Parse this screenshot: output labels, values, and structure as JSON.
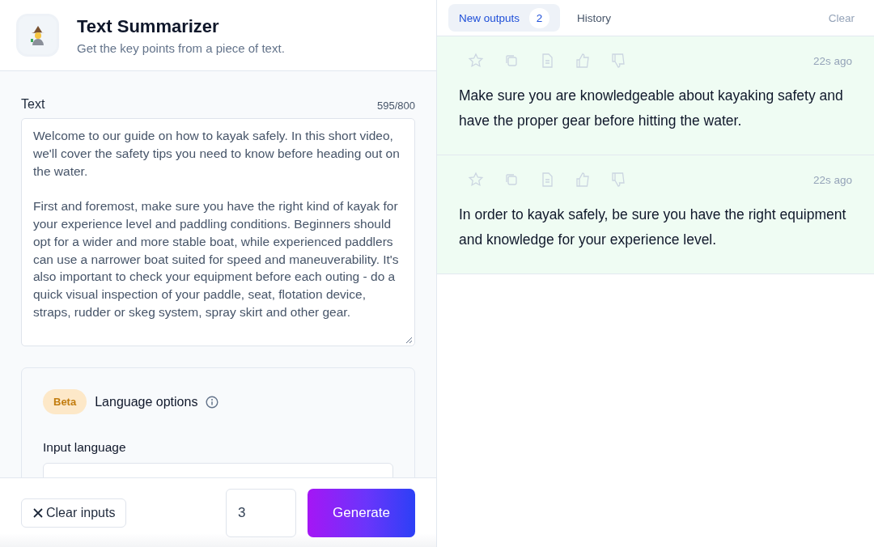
{
  "app": {
    "title": "Text Summarizer",
    "subtitle": "Get the key points from a piece of text."
  },
  "form": {
    "text_label": "Text",
    "counter": "595/800",
    "text_value": "Welcome to our guide on how to kayak safely. In this short video, we'll cover the safety tips you need to know before heading out on the water.\n\nFirst and foremost, make sure you have the right kind of kayak for your experience level and paddling conditions. Beginners should opt for a wider and more stable boat, while experienced paddlers can use a narrower boat suited for speed and maneuverability. It's also important to check your equipment before each outing - do a quick visual inspection of your paddle, seat, flotation device, straps, rudder or skeg system, spray skirt and other gear.",
    "options": {
      "badge": "Beta",
      "title": "Language options",
      "field_label": "Input language"
    }
  },
  "footer": {
    "clear_button": "Clear inputs",
    "count_value": "3",
    "generate_button": "Generate"
  },
  "tabs": [
    {
      "label": "New outputs",
      "badge": "2",
      "selected": true
    },
    {
      "label": "History",
      "selected": false
    }
  ],
  "clear_link": "Clear",
  "outputs": [
    {
      "time": "22s ago",
      "text": "Make sure you are knowledgeable about kayaking safety and have the proper gear before hitting the water."
    },
    {
      "time": "22s ago",
      "text": "In order to kayak safely, be sure you have the right equipment and knowledge for your experience level."
    }
  ]
}
